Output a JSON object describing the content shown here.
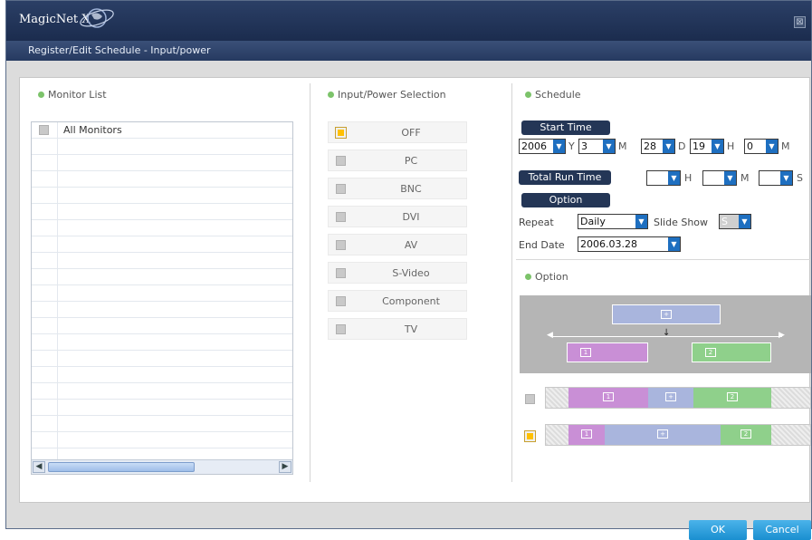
{
  "app": {
    "logo_text": "MagicNet X",
    "close_glyph": "⊠"
  },
  "dialog": {
    "title": "Register/Edit Schedule - Input/power"
  },
  "monitor_list": {
    "header": "Monitor List",
    "items": [
      {
        "label": "All Monitors",
        "checked": false
      }
    ],
    "empty_rows": 20
  },
  "input_power": {
    "header": "Input/Power Selection",
    "options": [
      {
        "label": "OFF",
        "selected": true
      },
      {
        "label": "PC",
        "selected": false
      },
      {
        "label": "BNC",
        "selected": false
      },
      {
        "label": "DVI",
        "selected": false
      },
      {
        "label": "AV",
        "selected": false
      },
      {
        "label": "S-Video",
        "selected": false
      },
      {
        "label": "Component",
        "selected": false
      },
      {
        "label": "TV",
        "selected": false
      }
    ]
  },
  "schedule": {
    "header": "Schedule",
    "start_time_label": "Start Time",
    "year": "2006",
    "year_unit": "Y",
    "month": "3",
    "month_unit": "M",
    "day": "28",
    "day_unit": "D",
    "hour": "19",
    "hour_unit": "H",
    "minute": "0",
    "minute_unit": "M",
    "total_run_time_label": "Total Run Time",
    "run_hours": "",
    "run_hours_unit": "H",
    "run_minutes": "",
    "run_minutes_unit": "M",
    "run_seconds": "",
    "run_seconds_unit": "S",
    "option_label": "Option",
    "repeat_label": "Repeat",
    "repeat_value": "Daily",
    "slideshow_label": "Slide Show",
    "slideshow_value": "S",
    "end_date_label": "End Date",
    "end_date_value": "2006.03.28"
  },
  "option_section": {
    "header": "Option",
    "diagram_labels": {
      "main": "+",
      "left": "1",
      "right": "2"
    },
    "row1_checked": false,
    "row2_checked": true,
    "row_labels": [
      "1",
      "+",
      "2"
    ]
  },
  "buttons": {
    "ok": "OK",
    "cancel": "Cancel"
  },
  "colors": {
    "accent": "#1a8fd0",
    "titlebar": "#1b2c4e",
    "pill": "#243656",
    "selected": "#ffc000",
    "purple": "#c98fd6",
    "blue": "#a9b5dd",
    "green": "#8fd08b"
  }
}
